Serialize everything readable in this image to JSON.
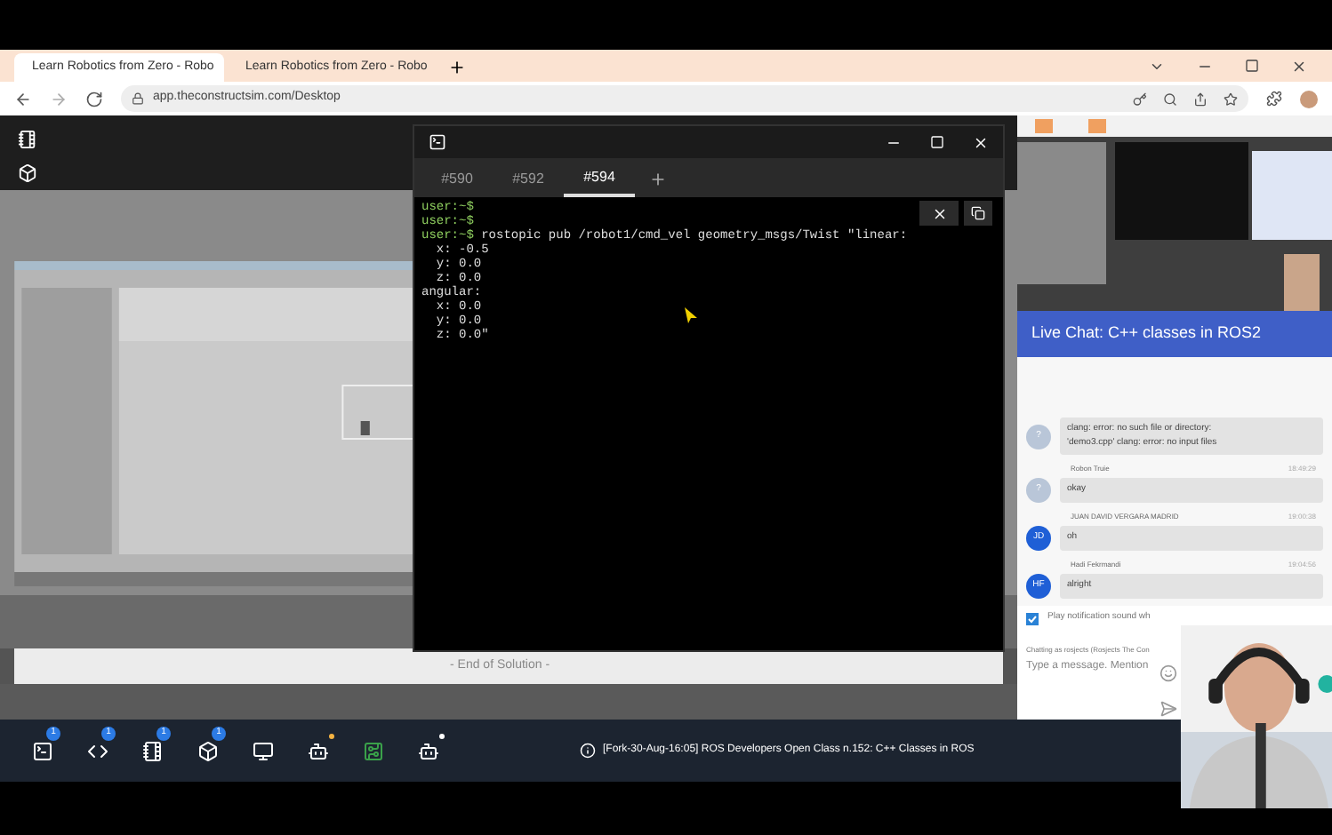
{
  "browser": {
    "tabs": [
      {
        "title": "Learn Robotics from Zero - Robo",
        "selected": true
      },
      {
        "title": "Learn Robotics from Zero - Robo",
        "selected": false
      }
    ],
    "url": "app.theconstructsim.com/Desktop"
  },
  "terminal": {
    "tabs": [
      {
        "label": "#590",
        "selected": false
      },
      {
        "label": "#592",
        "selected": false
      },
      {
        "label": "#594",
        "selected": true
      }
    ],
    "lines": [
      {
        "prompt": "user:~$"
      },
      {
        "prompt": "user:~$"
      },
      {
        "prompt": "user:~$",
        "text": " rostopic pub /robot1/cmd_vel geometry_msgs/Twist \"linear:"
      },
      {
        "text": "  x: -0.5"
      },
      {
        "text": "  y: 0.0"
      },
      {
        "text": "  z: 0.0"
      },
      {
        "text": "angular:"
      },
      {
        "text": "  x: 0.0"
      },
      {
        "text": "  y: 0.0"
      },
      {
        "text": "  z: 0.0\""
      }
    ]
  },
  "solution_footer": "- End of Solution -",
  "chat": {
    "title": "Live Chat: C++ classes in ROS2",
    "messages": [
      {
        "avatar": "?",
        "lines": [
          "clang: error: no such file or directory:",
          "'demo3.cpp' clang: error: no input files"
        ]
      },
      {
        "author": "Robon Truie",
        "time": "18:49:29",
        "avatar": "?",
        "lines": [
          "okay"
        ]
      },
      {
        "author": "JUAN DAVID VERGARA MADRID",
        "time": "19:00:38",
        "avatar": "JD",
        "lines": [
          "oh"
        ]
      },
      {
        "author": "Hadi Fekrmandi",
        "time": "19:04:56",
        "avatar": "HF",
        "lines": [
          "alright"
        ]
      }
    ],
    "notify": {
      "label": "Play notification sound wh",
      "checked": true
    },
    "chatting_as": "Chatting as rosjects (Rosjects The Con",
    "placeholder": "Type a message. Mention"
  },
  "taskbar": {
    "items": [
      {
        "kind": "terminal",
        "badge": "1"
      },
      {
        "kind": "code",
        "badge": "1"
      },
      {
        "kind": "notebook",
        "badge": "1"
      },
      {
        "kind": "cube",
        "badge": "1"
      },
      {
        "kind": "monitor"
      },
      {
        "kind": "robot",
        "color": "#f5b342"
      },
      {
        "kind": "board"
      },
      {
        "kind": "robot",
        "color": "#ffffff"
      }
    ],
    "status": "[Fork-30-Aug-16:05] ROS Developers Open Class n.152: C++ Classes in ROS"
  }
}
